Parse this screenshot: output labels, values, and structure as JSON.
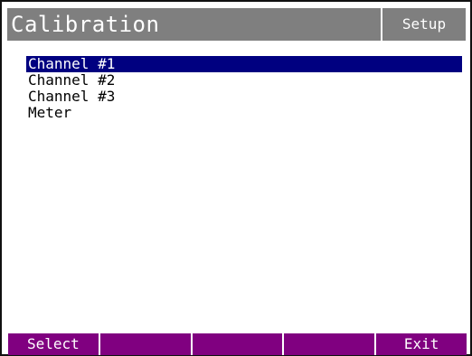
{
  "header": {
    "title": "Calibration",
    "mode": "Setup"
  },
  "menu": {
    "items": [
      {
        "label": "Channel #1",
        "selected": true
      },
      {
        "label": "Channel #2",
        "selected": false
      },
      {
        "label": "Channel #3",
        "selected": false
      },
      {
        "label": "Meter",
        "selected": false
      }
    ]
  },
  "softkeys": [
    {
      "label": "Select"
    },
    {
      "label": ""
    },
    {
      "label": ""
    },
    {
      "label": ""
    },
    {
      "label": "Exit"
    }
  ],
  "colors": {
    "header_bg": "#7f7f7f",
    "selection_bg": "#000080",
    "softkey_bg": "#800080"
  }
}
